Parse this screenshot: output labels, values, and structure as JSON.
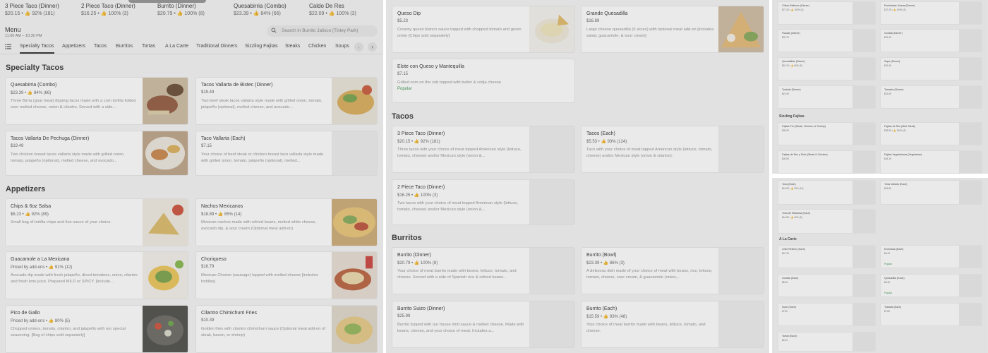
{
  "top_strip": [
    {
      "name": "3 Piece Taco (Dinner)",
      "meta": "$20.15 • 👍 92% (181)"
    },
    {
      "name": "2 Piece Taco (Dinner)",
      "meta": "$16.25 • 👍 100% (3)"
    },
    {
      "name": "Burrito (Dinner)",
      "meta": "$20.79 • 👍 100% (8)"
    },
    {
      "name": "Quesabirria (Combo)",
      "meta": "$23.39 • 👍 84% (66)"
    },
    {
      "name": "Caldo De Res",
      "meta": "$22.09 • 👍 100% (3)"
    }
  ],
  "menu": {
    "title": "Menu",
    "hours": "11:00 AM – 10:30 PM"
  },
  "search": {
    "placeholder": "Search in Burrito Jalisco (Tinley Park)"
  },
  "tabs": [
    "Specialty Tacos",
    "Appetizers",
    "Tacos",
    "Burritos",
    "Tortas",
    "A La Carte",
    "Traditional Dinners",
    "Sizzling Fajitas",
    "Steaks",
    "Chicken",
    "Soups"
  ],
  "icons": {
    "list": "list-icon",
    "search": "search-icon",
    "prev": "arrow-left-icon",
    "next": "arrow-right-icon"
  },
  "colors": {
    "popular": "#2f8a3e",
    "active_tab": "#1a1a1a"
  },
  "panel1": {
    "sections": [
      {
        "title": "Specialty Tacos",
        "items": [
          {
            "name": "Quesabirria (Combo)",
            "meta": "$23.39 • 👍 84% (66)",
            "desc": "Three Birria (goat meat) dipping tacos made with a corn tortilla folded over melted cheese, onion & cilantro. Served with a side..."
          },
          {
            "name": "Tacos Vallarta de Bistec (Dinner)",
            "meta": "$19.49",
            "desc": "Two beef steak tacos vallarta style made with grilled onion, tomato, jalapeño (optional), melted cheese, and avocado..."
          },
          {
            "name": "Tacos Vallarta De Pechuga (Dinner)",
            "meta": "$19.49",
            "desc": "Two chicken breast tacos vallarta style made with grilled onion, tomato, jalapeño (optional), melted cheese, and avocado..."
          },
          {
            "name": "Taco Vallarta (Each)",
            "meta": "$7.15",
            "desc": "Your choice of beef steak or chicken breast taco vallarta style made with grilled onion, tomato, jalapeño (optional), melted..."
          }
        ]
      },
      {
        "title": "Appetizers",
        "items": [
          {
            "name": "Chips & 6oz Salsa",
            "meta": "$6.23 • 👍 92% (89)",
            "desc": "Small bag of tortilla chips and 6oz sauce of your choice."
          },
          {
            "name": "Nachos Mexicanos",
            "meta": "$18.89 • 👍 85% (14)",
            "desc": "Mexican nachos made with refried beans, melted white cheese, avocado dip, & sour cream (Optional meat add-on)"
          },
          {
            "name": "Guacamole a La Mexicana",
            "meta": "Priced by add-ons • 👍 91% (12)",
            "desc": "Avocado dip made with fresh jalapeño, diced tomatoes, onion, cilantro and fresh lime juice. Prepared MILD or SPICY. [Include..."
          },
          {
            "name": "Choriqueso",
            "meta": "$16.79",
            "desc": "Mexican Chorizo (sausage) topped with melted cheese [includes tortillas]"
          },
          {
            "name": "Pico de Gallo",
            "meta": "Priced by add-ons • 👍 80% (5)",
            "desc": "Chopped onions, tomato, cilantro, and jalapeño with our special seasoning. [Bag of chips sold separately]"
          },
          {
            "name": "Cilantro Chimichurri Fries",
            "meta": "$10.39",
            "desc": "Golden fries with cilantro chimichurri sauce (Optional meat add-on of steak, bacon, or shrimp)"
          }
        ]
      }
    ]
  },
  "panel2": {
    "top_items": [
      {
        "name": "Queso Dip",
        "meta": "$5.23",
        "desc": "Creamy queso blanco sauce topped with chopped tomato and green onion [Chips sold separately]"
      },
      {
        "name": "Grande Quesadilla",
        "meta": "$16.89",
        "desc": "Large cheese quesadilla (5 slices) with optional meat add-on [includes salad, guacamole, & sour cream]"
      },
      {
        "name": "Elote con Queso y Mantequilla",
        "meta": "$7.15",
        "desc": "Grilled corn on the cob topped with butter & cotija cheese",
        "badge": "Popular"
      }
    ],
    "sections": [
      {
        "title": "Tacos",
        "items": [
          {
            "name": "3 Piece Taco (Dinner)",
            "meta": "$20.15 • 👍 92% (181)",
            "desc": "Three tacos with your choice of meat topped American style (lettuce, tomato, cheese) and/or Mexican style (onion &..."
          },
          {
            "name": "Tacos (Each)",
            "meta": "$5.53 • 👍 93% (124)",
            "desc": "Taco with your choice of meat topped American style (lettuce, tomato, cheese) and/or Mexican style (onion & cilantro)."
          },
          {
            "name": "2 Piece Taco (Dinner)",
            "meta": "$16.25 • 👍 100% (3)",
            "desc": "Two tacos with your choice of meat topped American style (lettuce, tomato, cheese) and/or Mexican style (onion &..."
          }
        ]
      },
      {
        "title": "Burritos",
        "items": [
          {
            "name": "Burrito (Dinner)",
            "meta": "$20.79 • 👍 100% (8)",
            "desc": "Your choice of meat burrito made with beans, lettuce, tomato, and cheese. Served with a side of Spanish rice & refried beans..."
          },
          {
            "name": "Burrito (Bowl)",
            "meta": "$23.39 • 👍 86% (3)",
            "desc": "A delicious dish made of your choice of meat with beans, rice, lettuce, tomato, cheese, sour cream, & guacamole (onion,..."
          },
          {
            "name": "Burrito Suizo (Dinner)",
            "meta": "$25.99",
            "desc": "Burrito topped with our house mild sauce & melted cheese. Made with beans, cheese, and your choice of meat. Includes a..."
          },
          {
            "name": "Burrito (Each)",
            "meta": "$15.59 • 👍 93% (48)",
            "desc": "Your choice of meat burrito made with beans, lettuce, tomato, and cheese."
          }
        ]
      }
    ]
  },
  "panel3": {
    "items": [
      {
        "name": "Chiles Rellenos (Dinner)",
        "meta": "$27.29 • 👍 100% (3)"
      },
      {
        "name": "Enchiladas Suizas (Dinner)",
        "meta": "$27.29 • 👍 100% (3)"
      },
      {
        "name": "Flautas (Dinner)",
        "meta": "$20.79"
      },
      {
        "name": "Gordita (Dinner)",
        "meta": "$19.49"
      },
      {
        "name": "Quesadillas (Dinner)",
        "meta": "$18.19 • 👍 80% (5)"
      },
      {
        "name": "Sope (Dinner)",
        "meta": "$19.49"
      },
      {
        "name": "Tostada (Dinner)",
        "meta": "$19.49"
      },
      {
        "name": "Tamales (Dinner)",
        "meta": "$19.49"
      }
    ],
    "section": "Sizzling Fajitas",
    "fajitas": [
      {
        "name": "Fajitas Trio (Steak, Chicken, & Shrimp)",
        "meta": "$35.09"
      },
      {
        "name": "Fajitas de Res (Skirt Steak)",
        "meta": "$28.59 • 👍 100% (3)"
      },
      {
        "name": "Fajitas de Res y Pollo (Steak & Chicken)",
        "meta": "$28.59"
      },
      {
        "name": "Fajitas Vegetarianas (Vegetarian)",
        "meta": "$18.19"
      }
    ]
  },
  "panel4": {
    "tortas": [
      {
        "name": "Torta (Each)",
        "meta": "$16.89 • 👍 90% (10)"
      },
      {
        "name": "Torta Vallarta (Each)",
        "meta": "$16.89"
      },
      {
        "name": "Torta de Milanesa (Each)",
        "meta": "$16.89 • 👍 80% (5)"
      }
    ],
    "section": "A La Carte",
    "items": [
      {
        "name": "Chile Relleno (Each)",
        "meta": "$10.39",
        "badge": ""
      },
      {
        "name": "Enchilada (Each)",
        "meta": "$6.49",
        "badge": "Popular"
      },
      {
        "name": "Gordita (Each)",
        "meta": "$8.45",
        "badge": ""
      },
      {
        "name": "Quesadilla (Each)",
        "meta": "$8.45",
        "badge": "Popular"
      },
      {
        "name": "Sope (Each)",
        "meta": "$7.80",
        "badge": ""
      },
      {
        "name": "Tostada (Each)",
        "meta": "$7.80",
        "badge": ""
      },
      {
        "name": "Tamal (Each)",
        "meta": "$6.49",
        "badge": ""
      }
    ]
  }
}
